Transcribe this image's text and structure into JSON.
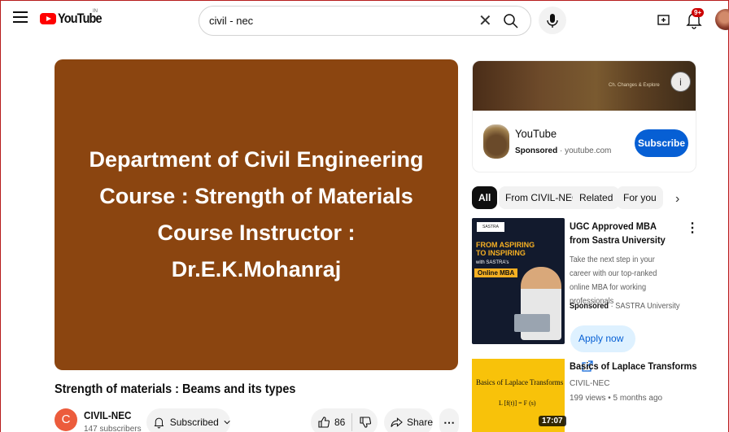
{
  "header": {
    "logo_text": "YouTube",
    "country_code": "IN",
    "search_value": "civil - nec",
    "notification_count": "9+"
  },
  "video": {
    "slide_lines": [
      "Department of Civil Engineering",
      "Course : Strength of Materials",
      "Course Instructor :",
      "Dr.E.K.Mohanraj"
    ],
    "title": "Strength of materials : Beams and its types",
    "channel_initial": "C",
    "channel_name": "CIVIL-NEC",
    "subscribers": "147 subscribers",
    "subscribed_label": "Subscribed",
    "like_count": "86",
    "share_label": "Share",
    "more_label": "⋯"
  },
  "ad_card": {
    "banner_text": "Ch. Changes & Explore",
    "info_label": "i",
    "advertiser": "YouTube",
    "sponsored_label": "Sponsored",
    "domain": "youtube.com",
    "subscribe_label": "Subscribe"
  },
  "chips": [
    "All",
    "From CIVIL-NEC",
    "Related",
    "For you"
  ],
  "sponsored_item": {
    "thumb_brand": "SASTRA",
    "thumb_line1": "FROM ASPIRING",
    "thumb_line2": "TO INSPIRING",
    "thumb_line3": "with SASTRA's",
    "thumb_line4": "Online MBA",
    "title": "UGC Approved MBA from Sastra University",
    "description": "Take the next step in your career with our top-ranked online MBA for working professionals",
    "sponsored_label": "Sponsored",
    "advertiser": "SASTRA University",
    "apply_label": "Apply now"
  },
  "related_video": {
    "thumb_title": "Basics of Laplace Transforms",
    "thumb_formula": "L [f(t)] = F (s)",
    "duration": "17:07",
    "title": "Basics of Laplace Transforms",
    "channel": "CIVIL-NEC",
    "meta": "199 views • 5 months ago"
  },
  "colors": {
    "slide_background": "#8b4510",
    "subscribe_blue": "#065fd4",
    "brand_red": "#ff0000"
  }
}
